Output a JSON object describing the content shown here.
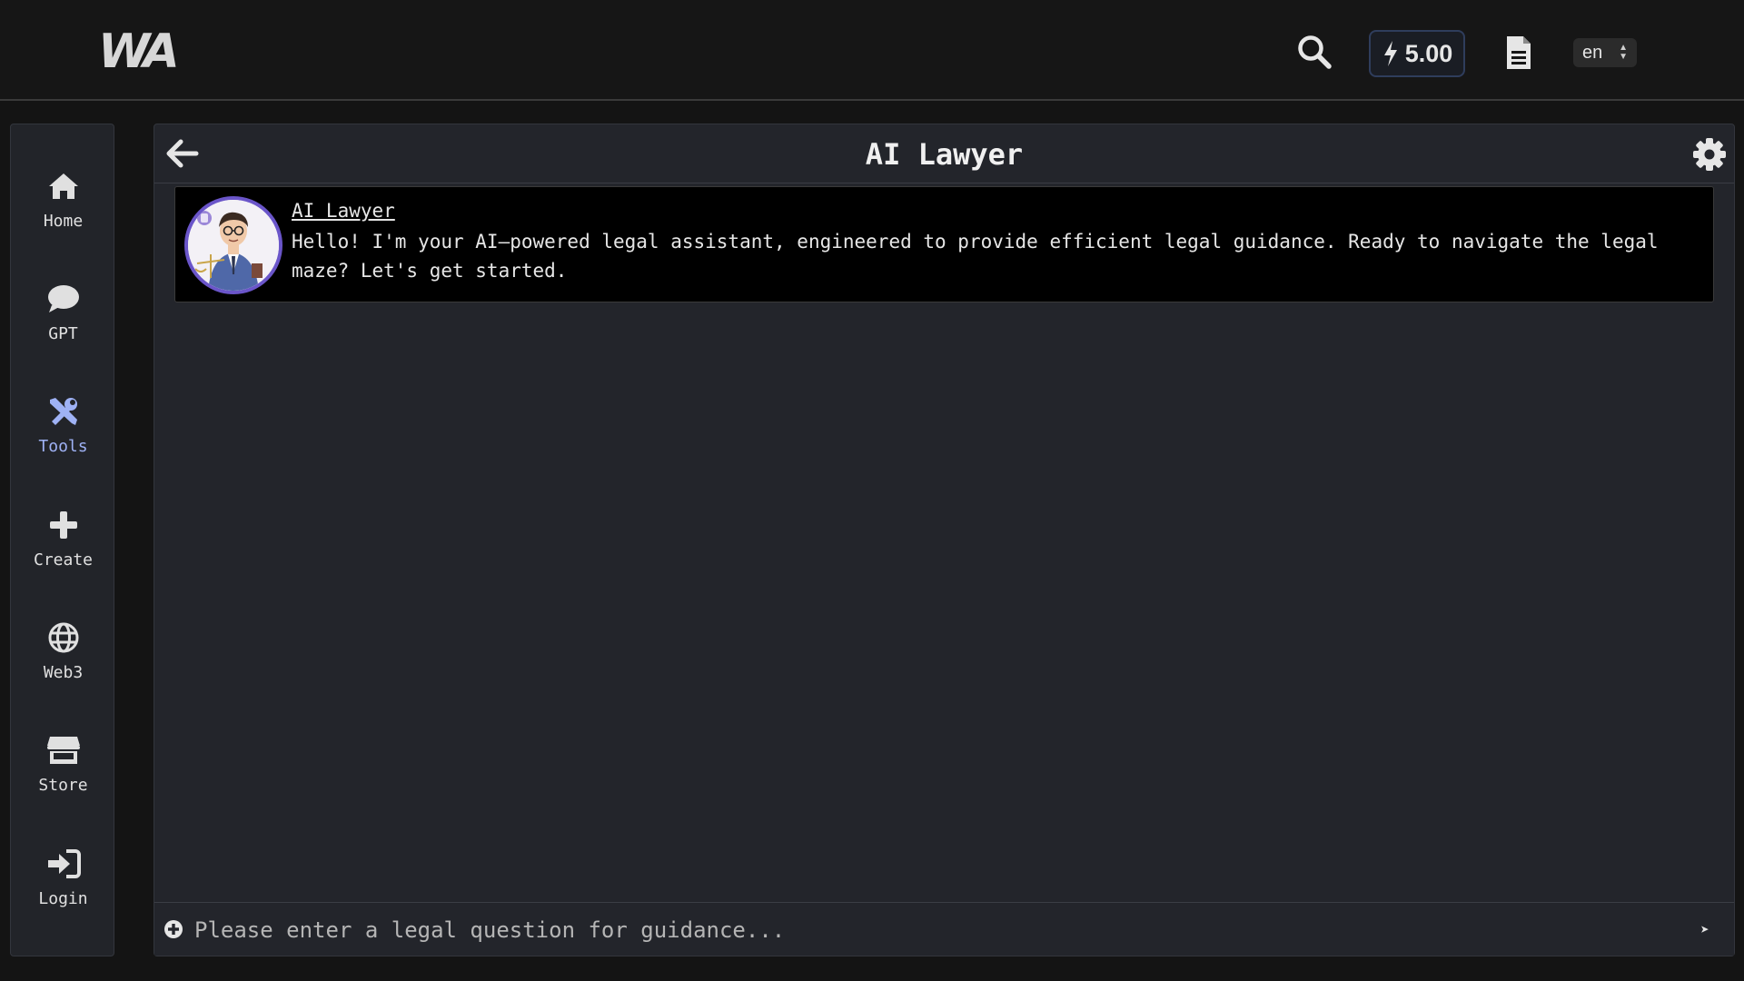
{
  "topbar": {
    "logo_text": "WA",
    "credits": "5.00",
    "language": "en",
    "icons": {
      "search": "search-icon",
      "credits": "bolt-icon",
      "document": "document-icon"
    }
  },
  "sidebar": {
    "items": [
      {
        "label": "Home",
        "icon": "home-icon",
        "active": false
      },
      {
        "label": "GPT",
        "icon": "chat-bubble-icon",
        "active": false
      },
      {
        "label": "Tools",
        "icon": "tools-icon",
        "active": true
      },
      {
        "label": "Create",
        "icon": "plus-icon",
        "active": false
      },
      {
        "label": "Web3",
        "icon": "globe-icon",
        "active": false
      },
      {
        "label": "Store",
        "icon": "store-icon",
        "active": false
      },
      {
        "label": "Login",
        "icon": "login-icon",
        "active": false
      }
    ]
  },
  "main": {
    "title": "AI Lawyer",
    "message": {
      "author": "AI Lawyer",
      "text": "Hello! I'm your AI–powered legal assistant, engineered to provide efficient legal guidance. Ready to navigate the legal maze? Let's get started."
    },
    "composer": {
      "placeholder": "Please enter a legal question for guidance...",
      "send_label": "➤"
    }
  },
  "colors": {
    "background": "#141414",
    "panel": "#23252b",
    "active_nav": "#9fb2f5",
    "avatar_border": "#6a55c9"
  }
}
